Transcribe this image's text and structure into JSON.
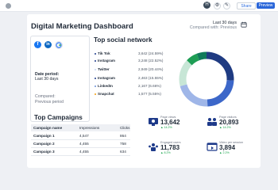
{
  "header": {
    "share_label": "Share",
    "preview_label": "Preview",
    "avatar_initials": "H"
  },
  "dashboard": {
    "title": "Digital Marketing Dashboard",
    "range_primary": "Last 30 days",
    "range_compared": "Compared with: Previous",
    "date_period_label": "Date period:",
    "date_period_value": "Last 30 days",
    "compared_label": "Compared:",
    "compared_value": "Previous period"
  },
  "social": {
    "title": "Top social network",
    "rows": [
      {
        "name": "Tik Tok",
        "value": "3,642 (24.59%)",
        "color": "#1e3a8a"
      },
      {
        "name": "Instagram",
        "value": "3,248 (22.52%)",
        "color": "#1e3a8a"
      },
      {
        "name": "Twitter",
        "value": "2,949 (20.44%)",
        "color": "#c7d6f5"
      },
      {
        "name": "Instagram",
        "value": "2,463 (15.55%)",
        "color": "#1e3a8a"
      },
      {
        "name": "LinkedIn",
        "value": "2,167 (6.66%)",
        "color": "#6b8fd6"
      },
      {
        "name": "Snapchat",
        "value": "1,577 (5.55%)",
        "color": "#f59e0b"
      }
    ],
    "donut_colors": [
      "#1f3b82",
      "#3c67c9",
      "#9fb6e8",
      "#c7e6d6",
      "#1e9e55",
      "#0f7a5a"
    ],
    "donut_values": [
      24.59,
      22.52,
      20.44,
      15.55,
      6.66,
      5.55
    ]
  },
  "campaigns": {
    "title": "Top Campaigns",
    "columns": [
      "Campaign name",
      "Impressions",
      "Clicks"
    ],
    "rows": [
      [
        "Campaign 1",
        "4,547",
        "864"
      ],
      [
        "Campaign 2",
        "4,455",
        "758"
      ],
      [
        "Campaign 3",
        "4,455",
        "634"
      ]
    ]
  },
  "metrics": [
    {
      "label": "Page views",
      "value": "13,642",
      "change": "▲ 14.2%"
    },
    {
      "label": "Page visitors",
      "value": "20,893",
      "change": "▲ 14.2%"
    },
    {
      "label": "Engaged users",
      "value": "11,783",
      "change": "▲ 8.2%"
    },
    {
      "label": "Video per session",
      "value": "3,894",
      "change": "▲ 2.2%"
    }
  ]
}
